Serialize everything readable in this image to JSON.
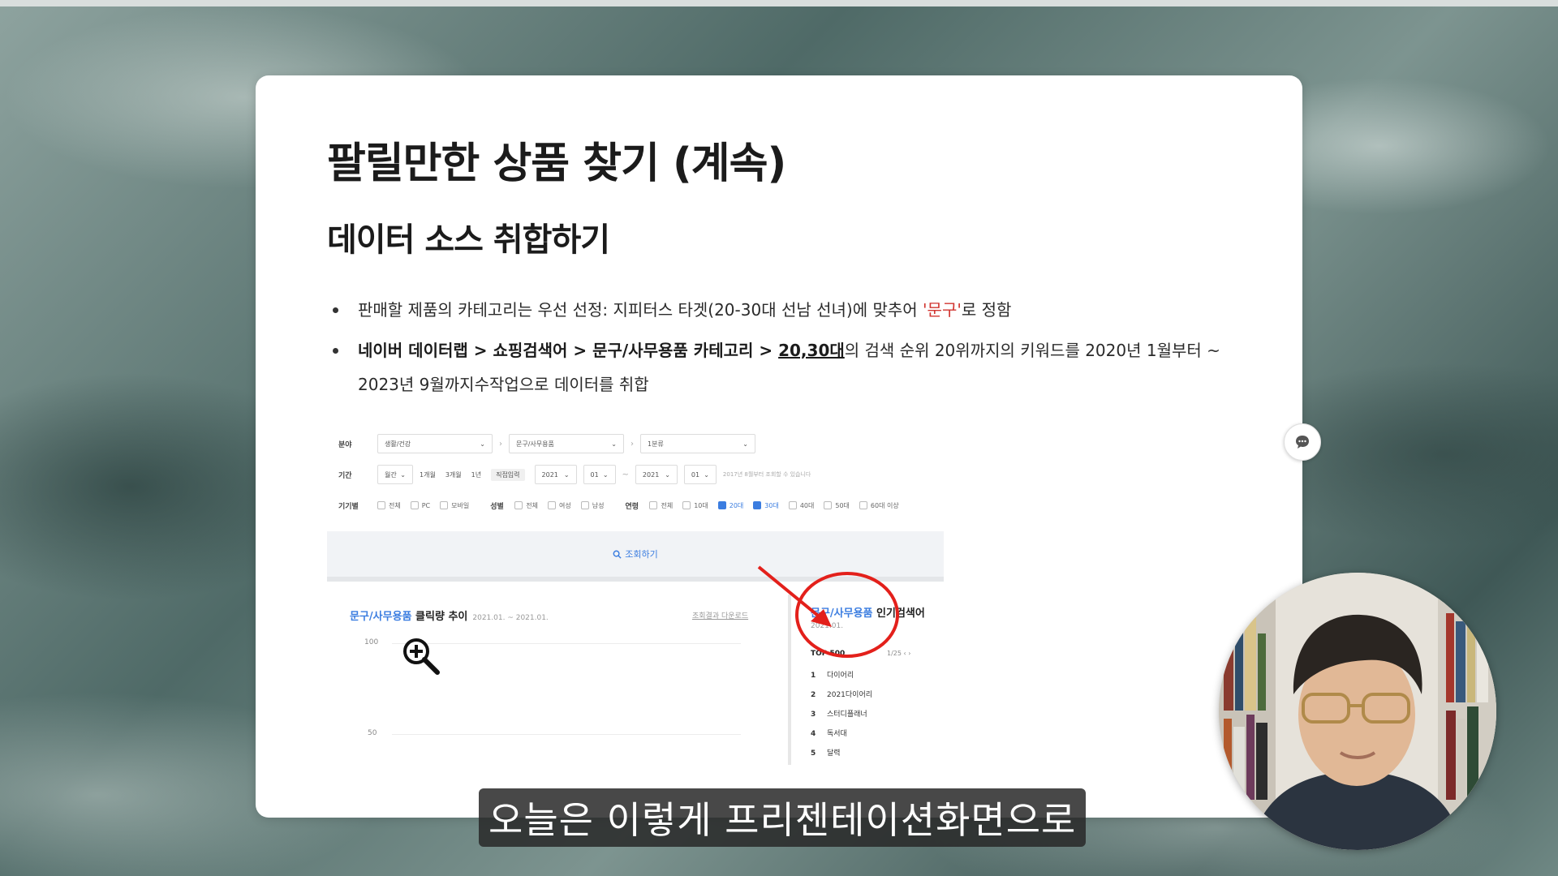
{
  "slide": {
    "title": "팔릴만한 상품 찾기 (계속)",
    "subtitle": "데이터 소스 취합하기",
    "bullet1": {
      "text_before": "판매할 제품의 카테고리는 우선 선정: 지피터스 타겟(20-30대 선남 선녀)에 맞추어 ",
      "highlight": "'문구'",
      "text_after": "로 정함"
    },
    "bullet2": {
      "bold_part": "네이버 데이터랩 > 쇼핑검색어 > 문구/사무용품 카테고리 > ",
      "underlined": "20,30대",
      "rest": "의 검색 순위 20위까지의 키워드를 2020년 1월부터 ~ 2023년 9월까지수작업으로 데이터를 취합"
    }
  },
  "screenshot": {
    "row1": {
      "label": "분야",
      "select1": "생활/건강",
      "select2": "문구/사무용품",
      "select3": "1분류"
    },
    "row2": {
      "label": "기간",
      "period": "월간",
      "pills": [
        "1개월",
        "3개월",
        "1년",
        "직접입력"
      ],
      "from_year": "2021",
      "from_month": "01",
      "to_year": "2021",
      "to_month": "01",
      "note": "2017년 8월부터 조회할 수 있습니다"
    },
    "row3": {
      "device_label": "기기별",
      "devices": [
        "전체",
        "PC",
        "모바일"
      ],
      "gender_label": "성별",
      "genders": [
        "전체",
        "여성",
        "남성"
      ],
      "age_label": "연령",
      "ages": [
        "전체",
        "10대",
        "20대",
        "30대",
        "40대",
        "50대",
        "60대 이상"
      ]
    },
    "search_button": "조회하기",
    "chart": {
      "category": "문구/사무용품",
      "title_suffix": " 클릭량 추이",
      "date_range": "2021.01. ~ 2021.01.",
      "download": "조회결과 다운로드",
      "ticks": [
        "100",
        "50"
      ]
    },
    "popular": {
      "category": "문구/사무용품",
      "title_suffix": " 인기검색어",
      "date": "2021.01.",
      "top_label": "TOP 500",
      "page": "1/25",
      "ranks": [
        {
          "n": "1",
          "kw": "다이어리"
        },
        {
          "n": "2",
          "kw": "2021다이어리"
        },
        {
          "n": "3",
          "kw": "스터디플래너"
        },
        {
          "n": "4",
          "kw": "독서대"
        },
        {
          "n": "5",
          "kw": "달력"
        }
      ]
    }
  },
  "caption": "오늘은 이렇게 프리젠테이션화면으로",
  "colors": {
    "accent_blue": "#3b7de0",
    "annotation_red": "#e3201b",
    "highlight_red": "#d1342f"
  },
  "icons": [
    "chat-icon",
    "magnifier-zoom-icon",
    "search-icon"
  ]
}
